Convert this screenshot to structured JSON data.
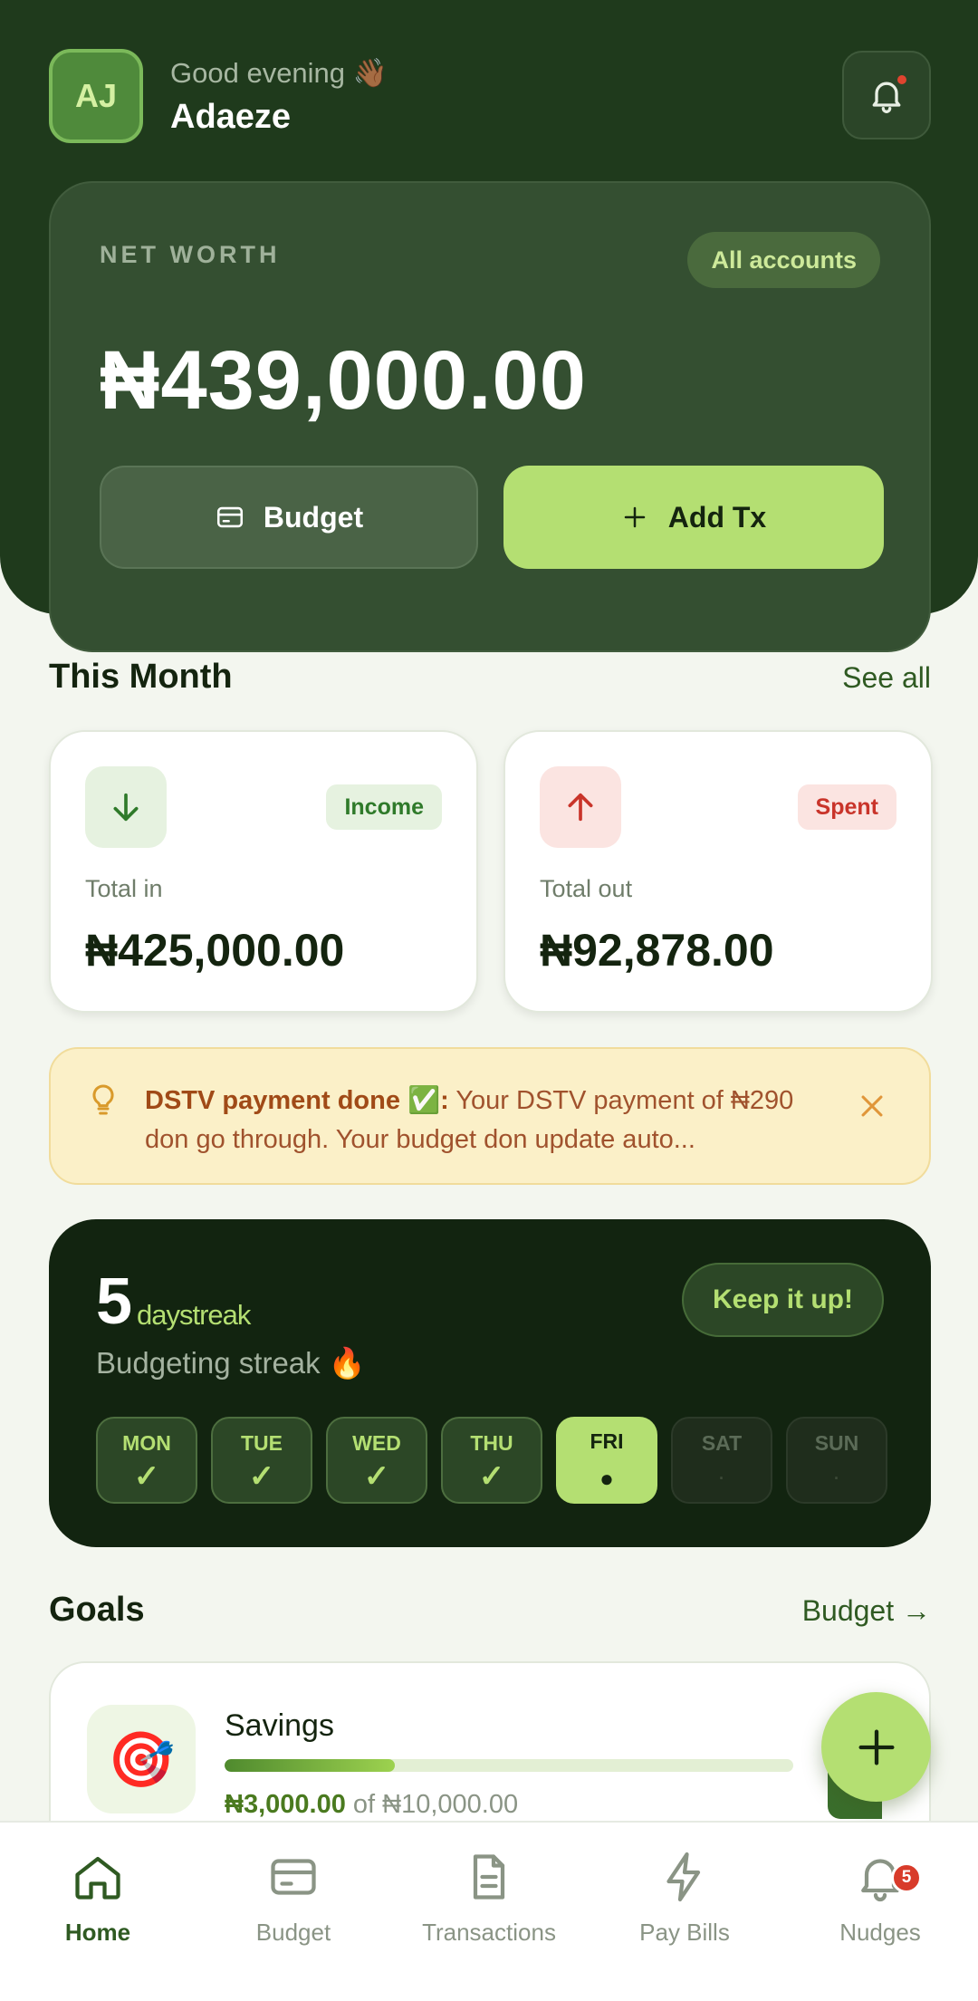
{
  "header": {
    "avatar_initials": "AJ",
    "greeting": "Good evening 👋🏾",
    "user_name": "Adaeze",
    "notification_dot": true
  },
  "net_worth": {
    "label": "NET WORTH",
    "account_filter": "All accounts",
    "amount": "₦439,000.00",
    "budget_button": "Budget",
    "add_tx_button": "Add Tx"
  },
  "this_month": {
    "title": "This Month",
    "see_all": "See all",
    "income": {
      "tag": "Income",
      "label": "Total in",
      "value": "₦425,000.00",
      "icon": "arrow-down-icon"
    },
    "spent": {
      "tag": "Spent",
      "label": "Total out",
      "value": "₦92,878.00",
      "icon": "arrow-up-icon"
    }
  },
  "notice": {
    "title": "DSTV payment done ✅:",
    "body": " Your DSTV payment of ₦290 don go through. Your budget don update auto..."
  },
  "streak": {
    "count": "5",
    "unit": "daystreak",
    "subtitle": "Budgeting streak 🔥",
    "cta": "Keep it up!",
    "days": [
      {
        "label": "MON",
        "mark": "✓",
        "state": "done"
      },
      {
        "label": "TUE",
        "mark": "✓",
        "state": "done"
      },
      {
        "label": "WED",
        "mark": "✓",
        "state": "done"
      },
      {
        "label": "THU",
        "mark": "✓",
        "state": "done"
      },
      {
        "label": "FRI",
        "mark": "●",
        "state": "today"
      },
      {
        "label": "SAT",
        "mark": "·",
        "state": "future"
      },
      {
        "label": "SUN",
        "mark": "·",
        "state": "future"
      }
    ]
  },
  "goals": {
    "title": "Goals",
    "link": "Budget →",
    "items": [
      {
        "icon": "🎯",
        "name": "Savings",
        "current": "₦3,000.00",
        "of_text": " of ₦10,000.00",
        "progress": 0.3
      }
    ]
  },
  "tabbar": {
    "items": [
      {
        "label": "Home",
        "icon": "home-icon",
        "active": true
      },
      {
        "label": "Budget",
        "icon": "card-icon",
        "active": false
      },
      {
        "label": "Transactions",
        "icon": "document-icon",
        "active": false
      },
      {
        "label": "Pay Bills",
        "icon": "lightning-icon",
        "active": false
      },
      {
        "label": "Nudges",
        "icon": "bell-icon",
        "active": false,
        "badge": "5"
      }
    ]
  },
  "colors": {
    "brand_dark": "#1f3a1c",
    "accent_lime": "#b4df72",
    "income_green": "#2f7a2a",
    "spent_red": "#c9342a"
  }
}
